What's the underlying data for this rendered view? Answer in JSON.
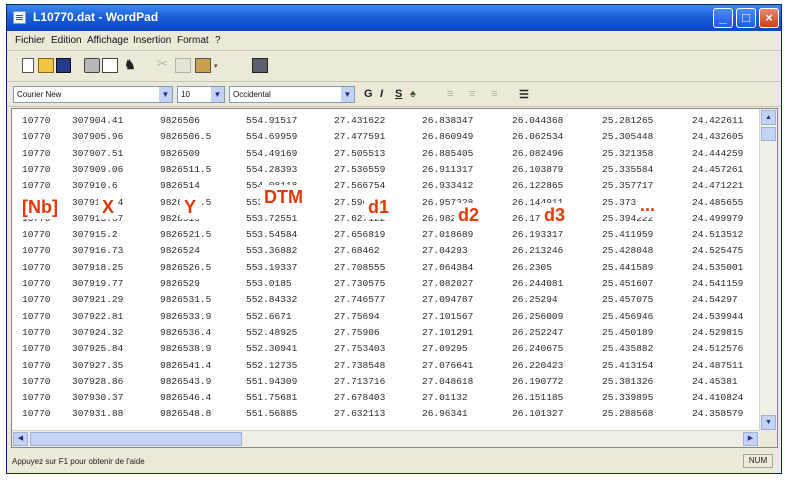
{
  "window": {
    "title": "L10770.dat - WordPad",
    "buttons": {
      "minimize": "_",
      "maximize": "□",
      "close": "×"
    }
  },
  "menu": [
    "Fichier",
    "Edition",
    "Affichage",
    "Insertion",
    "Format",
    "?"
  ],
  "toolbar": {
    "icons": [
      "new-document-icon",
      "open-folder-icon",
      "save-disk-icon",
      "print-icon",
      "print-preview-icon",
      "find-binoculars-icon",
      "cut-scissors-icon",
      "copy-icon",
      "paste-icon",
      "insert-datetime-icon"
    ],
    "find_glyph": "♞",
    "cut_glyph": "✂",
    "dropdown_glyph": "▾"
  },
  "format": {
    "font": "Courier New",
    "size": "10",
    "script": "Occidental",
    "bold": "G",
    "italic": "I",
    "underline": "S",
    "color_glyph": "♠",
    "align": [
      "≡",
      "≡",
      "≡"
    ],
    "bullets": "☰",
    "dropdown_glyph": "▼"
  },
  "table": {
    "rows": [
      [
        "10770",
        "307904.41",
        "9826506",
        "554.91517",
        "27.431622",
        "26.838347",
        "26.044368",
        "25.281265",
        "24.422611"
      ],
      [
        "10770",
        "307905.96",
        "9826506.5",
        "554.69959",
        "27.477591",
        "26.860949",
        "26.062534",
        "25.305448",
        "24.432605"
      ],
      [
        "10770",
        "307907.51",
        "9826509",
        "554.49169",
        "27.505513",
        "26.885405",
        "26.082496",
        "25.321358",
        "24.444259"
      ],
      [
        "10770",
        "307909.06",
        "9826511.5",
        "554.28393",
        "27.536559",
        "26.911317",
        "26.103879",
        "25.335584",
        "24.457261"
      ],
      [
        "10770",
        "307910.6",
        "9826514",
        "554.08118",
        "27.566754",
        "26.933412",
        "26.122865",
        "25.357717",
        "24.471221"
      ],
      [
        "10770",
        "307912.14",
        "9826516.5",
        "553.9089",
        "27.596909",
        "26.957328",
        "26.144911",
        "25.373776",
        "24.485655"
      ],
      [
        "10770",
        "307913.67",
        "9826519",
        "553.72551",
        "27.627122",
        "26.982603",
        "26.171635",
        "25.394222",
        "24.499979"
      ],
      [
        "10770",
        "307915.2",
        "9826521.5",
        "553.54584",
        "27.656819",
        "27.018689",
        "26.193317",
        "25.411959",
        "24.513512"
      ],
      [
        "10770",
        "307916.73",
        "9826524",
        "553.36882",
        "27.68462",
        "27.04293",
        "26.213246",
        "25.428048",
        "24.525475"
      ],
      [
        "10770",
        "307918.25",
        "9826526.5",
        "553.19337",
        "27.708555",
        "27.064384",
        "26.2305",
        "25.441589",
        "24.535001"
      ],
      [
        "10770",
        "307919.77",
        "9826529",
        "553.0185",
        "27.730575",
        "27.082027",
        "26.244081",
        "25.451607",
        "24.541159"
      ],
      [
        "10770",
        "307921.29",
        "9826531.5",
        "552.84332",
        "27.746577",
        "27.094787",
        "26.25294",
        "25.457075",
        "24.54297"
      ],
      [
        "10770",
        "307922.81",
        "9826533.9",
        "552.6671",
        "27.75694",
        "27.101567",
        "26.256009",
        "25.456946",
        "24.539944"
      ],
      [
        "10770",
        "307924.32",
        "9826536.4",
        "552.48925",
        "27.75906",
        "27.101291",
        "26.252247",
        "25.450189",
        "24.529815"
      ],
      [
        "10770",
        "307925.84",
        "9826538.9",
        "552.30941",
        "27.753403",
        "27.09295",
        "26.240675",
        "25.435882",
        "24.512576"
      ],
      [
        "10770",
        "307927.35",
        "9826541.4",
        "552.12735",
        "27.738548",
        "27.076641",
        "26.220423",
        "25.413154",
        "24.487511"
      ],
      [
        "10770",
        "307928.86",
        "9826543.9",
        "551.94309",
        "27.713716",
        "27.048618",
        "26.190772",
        "25.381326",
        "24.45381"
      ],
      [
        "10770",
        "307930.37",
        "9826546.4",
        "551.75681",
        "27.678403",
        "27.01132",
        "26.151185",
        "25.339895",
        "24.410824"
      ],
      [
        "10770",
        "307931.88",
        "9826548.8",
        "551.56885",
        "27.632113",
        "26.96341",
        "26.101327",
        "25.288568",
        "24.358579"
      ]
    ]
  },
  "overlay_labels": [
    "[Nb]",
    "X",
    "Y",
    "DTM",
    "d1",
    "d2",
    "d3",
    "..."
  ],
  "scrollbars": {
    "up": "▲",
    "down": "▼",
    "left": "◀",
    "right": "▶"
  },
  "status": {
    "help": "Appuyez sur F1 pour obtenir de l'aide",
    "num": "NUM"
  }
}
